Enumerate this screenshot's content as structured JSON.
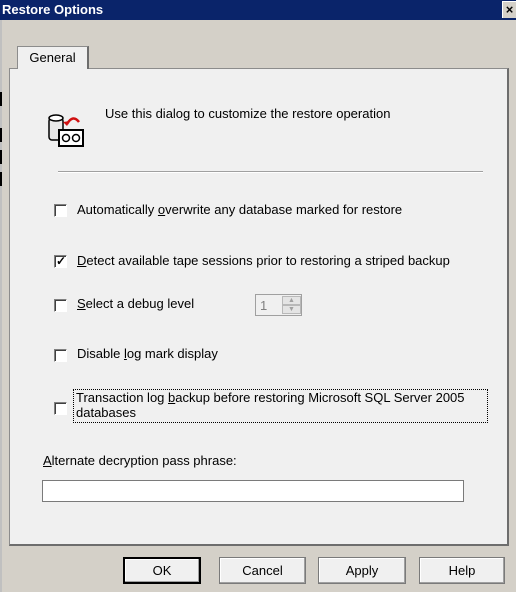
{
  "window": {
    "title": "Restore Options",
    "close_glyph": "×"
  },
  "tabs": [
    {
      "label": "General",
      "active": true
    }
  ],
  "intro": {
    "icon": "database-restore-icon",
    "text": "Use this dialog to customize the restore operation"
  },
  "options": {
    "overwrite": {
      "pre": "Automatically ",
      "key": "o",
      "post": "verwrite any database marked for restore",
      "checked": false
    },
    "detect_tape": {
      "pre": "",
      "key": "D",
      "post": "etect available tape sessions prior to restoring a striped backup",
      "checked": true
    },
    "debug_level": {
      "pre": "",
      "key": "S",
      "post": "elect a debug level",
      "checked": false,
      "value": "1"
    },
    "disable_log": {
      "pre": "Disable ",
      "key": "l",
      "post": "og mark display",
      "checked": false
    },
    "txn_log": {
      "line1_pre": "Transaction log ",
      "key": "b",
      "line1_post": "ackup before restoring Microsoft SQL Server 2005",
      "line2": "databases",
      "checked": false
    }
  },
  "passphrase": {
    "label_key": "A",
    "label_rest": "lternate decryption pass phrase:",
    "value": ""
  },
  "buttons": {
    "ok": "OK",
    "cancel": "Cancel",
    "apply": "Apply",
    "help": "Help"
  },
  "colors": {
    "titlebar": "#0a246a",
    "dialog_bg": "#d4d0c8",
    "panel_bg": "#f0f0f0"
  }
}
